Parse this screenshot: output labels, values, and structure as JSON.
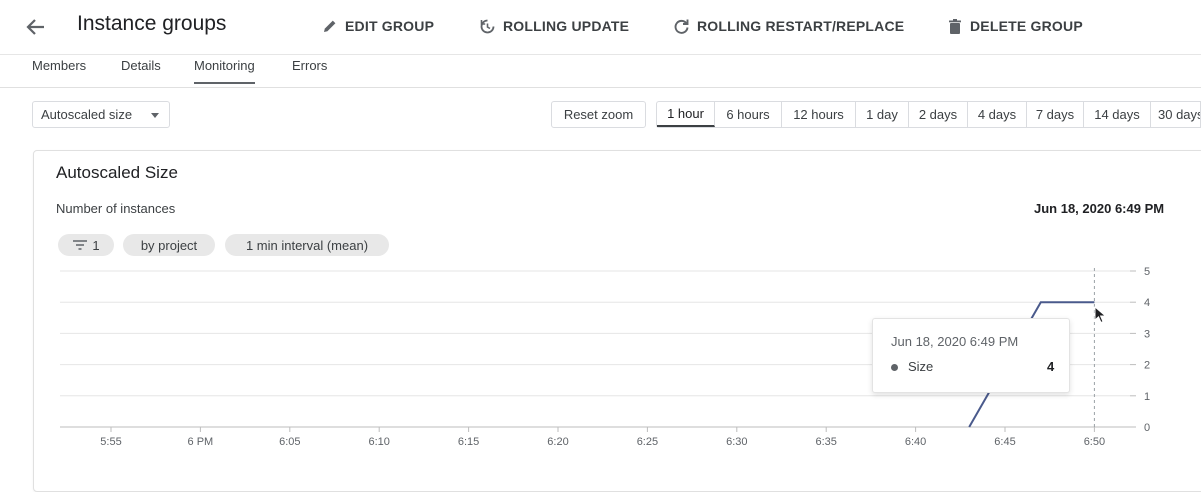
{
  "header": {
    "title": "Instance groups",
    "actions": [
      {
        "label": "EDIT GROUP",
        "icon": "pencil-icon"
      },
      {
        "label": "ROLLING UPDATE",
        "icon": "rolling-update-icon"
      },
      {
        "label": "ROLLING RESTART/REPLACE",
        "icon": "refresh-icon"
      },
      {
        "label": "DELETE GROUP",
        "icon": "trash-icon"
      }
    ]
  },
  "tabs": [
    {
      "label": "Members"
    },
    {
      "label": "Details"
    },
    {
      "label": "Monitoring",
      "active": true
    },
    {
      "label": "Errors"
    }
  ],
  "toolbar": {
    "metric_select": "Autoscaled size",
    "reset_zoom": "Reset zoom",
    "ranges": [
      "1 hour",
      "6 hours",
      "12 hours",
      "1 day",
      "2 days",
      "4 days",
      "7 days",
      "14 days",
      "30 days"
    ],
    "active_range": "1 hour"
  },
  "card": {
    "title": "Autoscaled Size",
    "subtitle": "Number of instances",
    "timestamp": "Jun 18, 2020 6:49 PM",
    "chips": {
      "filter_count": "1",
      "group_by": "by project",
      "interval": "1 min interval (mean)"
    }
  },
  "tooltip": {
    "date": "Jun 18, 2020 6:49 PM",
    "series": "Size",
    "value": "4"
  },
  "chart_data": {
    "type": "line",
    "title": "Autoscaled Size",
    "ylabel": "Number of instances",
    "x_ticks": [
      "5:55",
      "6 PM",
      "6:05",
      "6:10",
      "6:15",
      "6:20",
      "6:25",
      "6:30",
      "6:35",
      "6:40",
      "6:45",
      "6:50"
    ],
    "y_ticks": [
      0,
      1,
      2,
      3,
      4,
      5
    ],
    "ylim": [
      0,
      5
    ],
    "grid": true,
    "series": [
      {
        "name": "Size",
        "color": "#4a5a8c",
        "points": [
          [
            "6:43",
            0
          ],
          [
            "6:47",
            4
          ],
          [
            "6:50",
            4
          ]
        ]
      }
    ],
    "cursor_time": "6:50"
  }
}
